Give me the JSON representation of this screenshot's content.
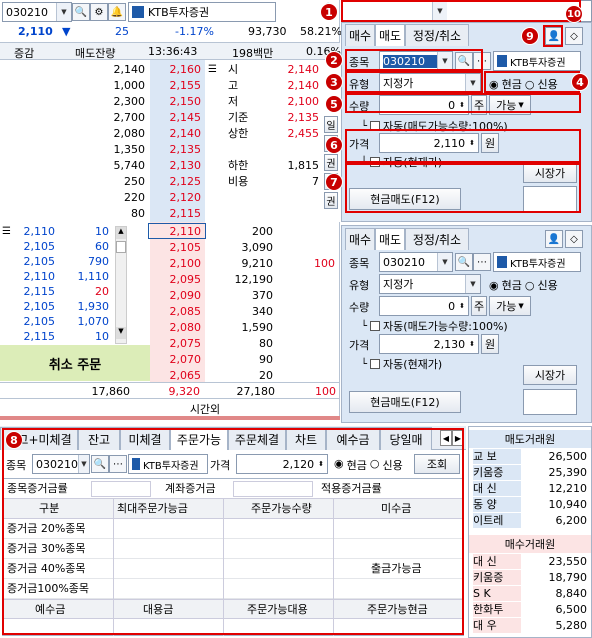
{
  "top": {
    "code": "030210",
    "name": "KTB투자증권",
    "price": "2,110",
    "arrow": "▼",
    "change": "25",
    "change_pct": "-1.17%",
    "volume": "93,730",
    "volume_ratio": "58.21%"
  },
  "ob_header": {
    "c1": "증감",
    "c2": "매도잔량",
    "time": "13:36:43",
    "c4": "198백만",
    "c5": "0.16%"
  },
  "asks": [
    {
      "qty": "2,140",
      "price": "2,160"
    },
    {
      "qty": "1,000",
      "price": "2,155"
    },
    {
      "qty": "2,300",
      "price": "2,150"
    },
    {
      "qty": "2,700",
      "price": "2,145"
    },
    {
      "qty": "2,080",
      "price": "2,140"
    },
    {
      "qty": "1,350",
      "price": "2,135"
    },
    {
      "qty": "5,740",
      "price": "2,130"
    },
    {
      "qty": "250",
      "price": "2,125"
    },
    {
      "qty": "220",
      "price": "2,120"
    },
    {
      "qty": "80",
      "price": "2,115"
    }
  ],
  "info": [
    {
      "k": "시",
      "v": "2,140"
    },
    {
      "k": "고",
      "v": "2,140"
    },
    {
      "k": "저",
      "v": "2,100"
    },
    {
      "k": "기준",
      "v": "2,135"
    },
    {
      "k": "상한",
      "v": "2,455"
    },
    {
      "k": "하한",
      "v": "1,815"
    },
    {
      "k": "비용",
      "v": "7"
    }
  ],
  "side_btns": [
    "일",
    "유",
    "권",
    "다",
    "권"
  ],
  "trades": [
    {
      "price": "2,110",
      "qty": "10"
    },
    {
      "price": "2,105",
      "qty": "60"
    },
    {
      "price": "2,105",
      "qty": "790"
    },
    {
      "price": "2,110",
      "qty": "1,110"
    },
    {
      "price": "2,115",
      "qty": "20"
    },
    {
      "price": "2,105",
      "qty": "1,930"
    },
    {
      "price": "2,105",
      "qty": "1,070"
    },
    {
      "price": "2,115",
      "qty": "10"
    }
  ],
  "bids": [
    {
      "price": "2,110",
      "qty": "200",
      "x": ""
    },
    {
      "price": "2,105",
      "qty": "3,090",
      "x": ""
    },
    {
      "price": "2,100",
      "qty": "9,210",
      "x": "100"
    },
    {
      "price": "2,095",
      "qty": "12,190",
      "x": ""
    },
    {
      "price": "2,090",
      "qty": "370",
      "x": ""
    },
    {
      "price": "2,085",
      "qty": "340",
      "x": ""
    },
    {
      "price": "2,080",
      "qty": "1,590",
      "x": ""
    },
    {
      "price": "2,075",
      "qty": "80",
      "x": ""
    },
    {
      "price": "2,070",
      "qty": "90",
      "x": ""
    },
    {
      "price": "2,065",
      "qty": "20",
      "x": ""
    }
  ],
  "cancel_label": "취소 주문",
  "totals": {
    "ask": "17,860",
    "mid": "9,320",
    "bid": "27,180",
    "x": "100",
    "after": "시간외"
  },
  "order1": {
    "tabs": [
      "매수",
      "매도",
      "정정/취소"
    ],
    "code_label": "종목",
    "code": "030210",
    "name": "KTB투자증권",
    "type_label": "유형",
    "type": "지정가",
    "cash": "현금",
    "credit": "신용",
    "qty_label": "수량",
    "qty": "0",
    "ju": "주",
    "avail": "가능",
    "auto": "자동(매도가능수량:100%)",
    "price_label": "가격",
    "price": "2,110",
    "won": "원",
    "auto2": "자동(현재가)",
    "market": "시장가",
    "submit": "현금매도(F12)"
  },
  "order2": {
    "tabs": [
      "매수",
      "매도",
      "정정/취소"
    ],
    "code_label": "종목",
    "code": "030210",
    "name": "KTB투자증권",
    "type_label": "유형",
    "type": "지정가",
    "cash": "현금",
    "credit": "신용",
    "qty_label": "수량",
    "qty": "0",
    "ju": "주",
    "avail": "가능",
    "auto": "자동(매도가능수량:100%)",
    "price_label": "가격",
    "price": "2,130",
    "won": "원",
    "auto2": "자동(현재가)",
    "market": "시장가",
    "submit": "현금매도(F12)"
  },
  "badges": [
    "1",
    "2",
    "3",
    "4",
    "5",
    "6",
    "7",
    "8",
    "9",
    "10"
  ],
  "bottom": {
    "tabs": [
      "잔고+미체결",
      "잔고",
      "미체결",
      "주문가능",
      "주문체결",
      "차트",
      "예수금",
      "당일매"
    ],
    "code_label": "종목",
    "code": "030210",
    "name": "KTB투자증권",
    "price_label": "가격",
    "price": "2,120",
    "cash": "현금",
    "credit": "신용",
    "query": "조회",
    "margin": {
      "a": "종목증거금률",
      "b": "계좌증거금",
      "c": "적용증거금률"
    },
    "hdr": [
      "구분",
      "최대주문가능금",
      "주문가능수량",
      "미수금"
    ],
    "rows": [
      "증거금 20%종목",
      "증거금 30%종목",
      "증거금 40%종목",
      "증거금100%종목"
    ],
    "withdraw": "출금가능금",
    "hdr2": [
      "예수금",
      "대용금",
      "주문가능대용",
      "주문가능현금"
    ]
  },
  "brokers": {
    "sell_title": "매도거래원",
    "sell": [
      {
        "n": "교 보",
        "v": "26,500"
      },
      {
        "n": "키움증",
        "v": "25,390"
      },
      {
        "n": "대 신",
        "v": "12,210"
      },
      {
        "n": "동 양",
        "v": "10,940"
      },
      {
        "n": "이트레",
        "v": "6,200"
      }
    ],
    "buy_title": "매수거래원",
    "buy": [
      {
        "n": "대 신",
        "v": "23,550"
      },
      {
        "n": "키움증",
        "v": "18,790"
      },
      {
        "n": "S K",
        "v": "8,840"
      },
      {
        "n": "한화투",
        "v": "6,500"
      },
      {
        "n": "대 우",
        "v": "5,280"
      }
    ]
  },
  "colors": {
    "red": "#e0001a",
    "blue": "#0044cc",
    "panel": "#dbe7f5",
    "badge": "#c80000"
  }
}
